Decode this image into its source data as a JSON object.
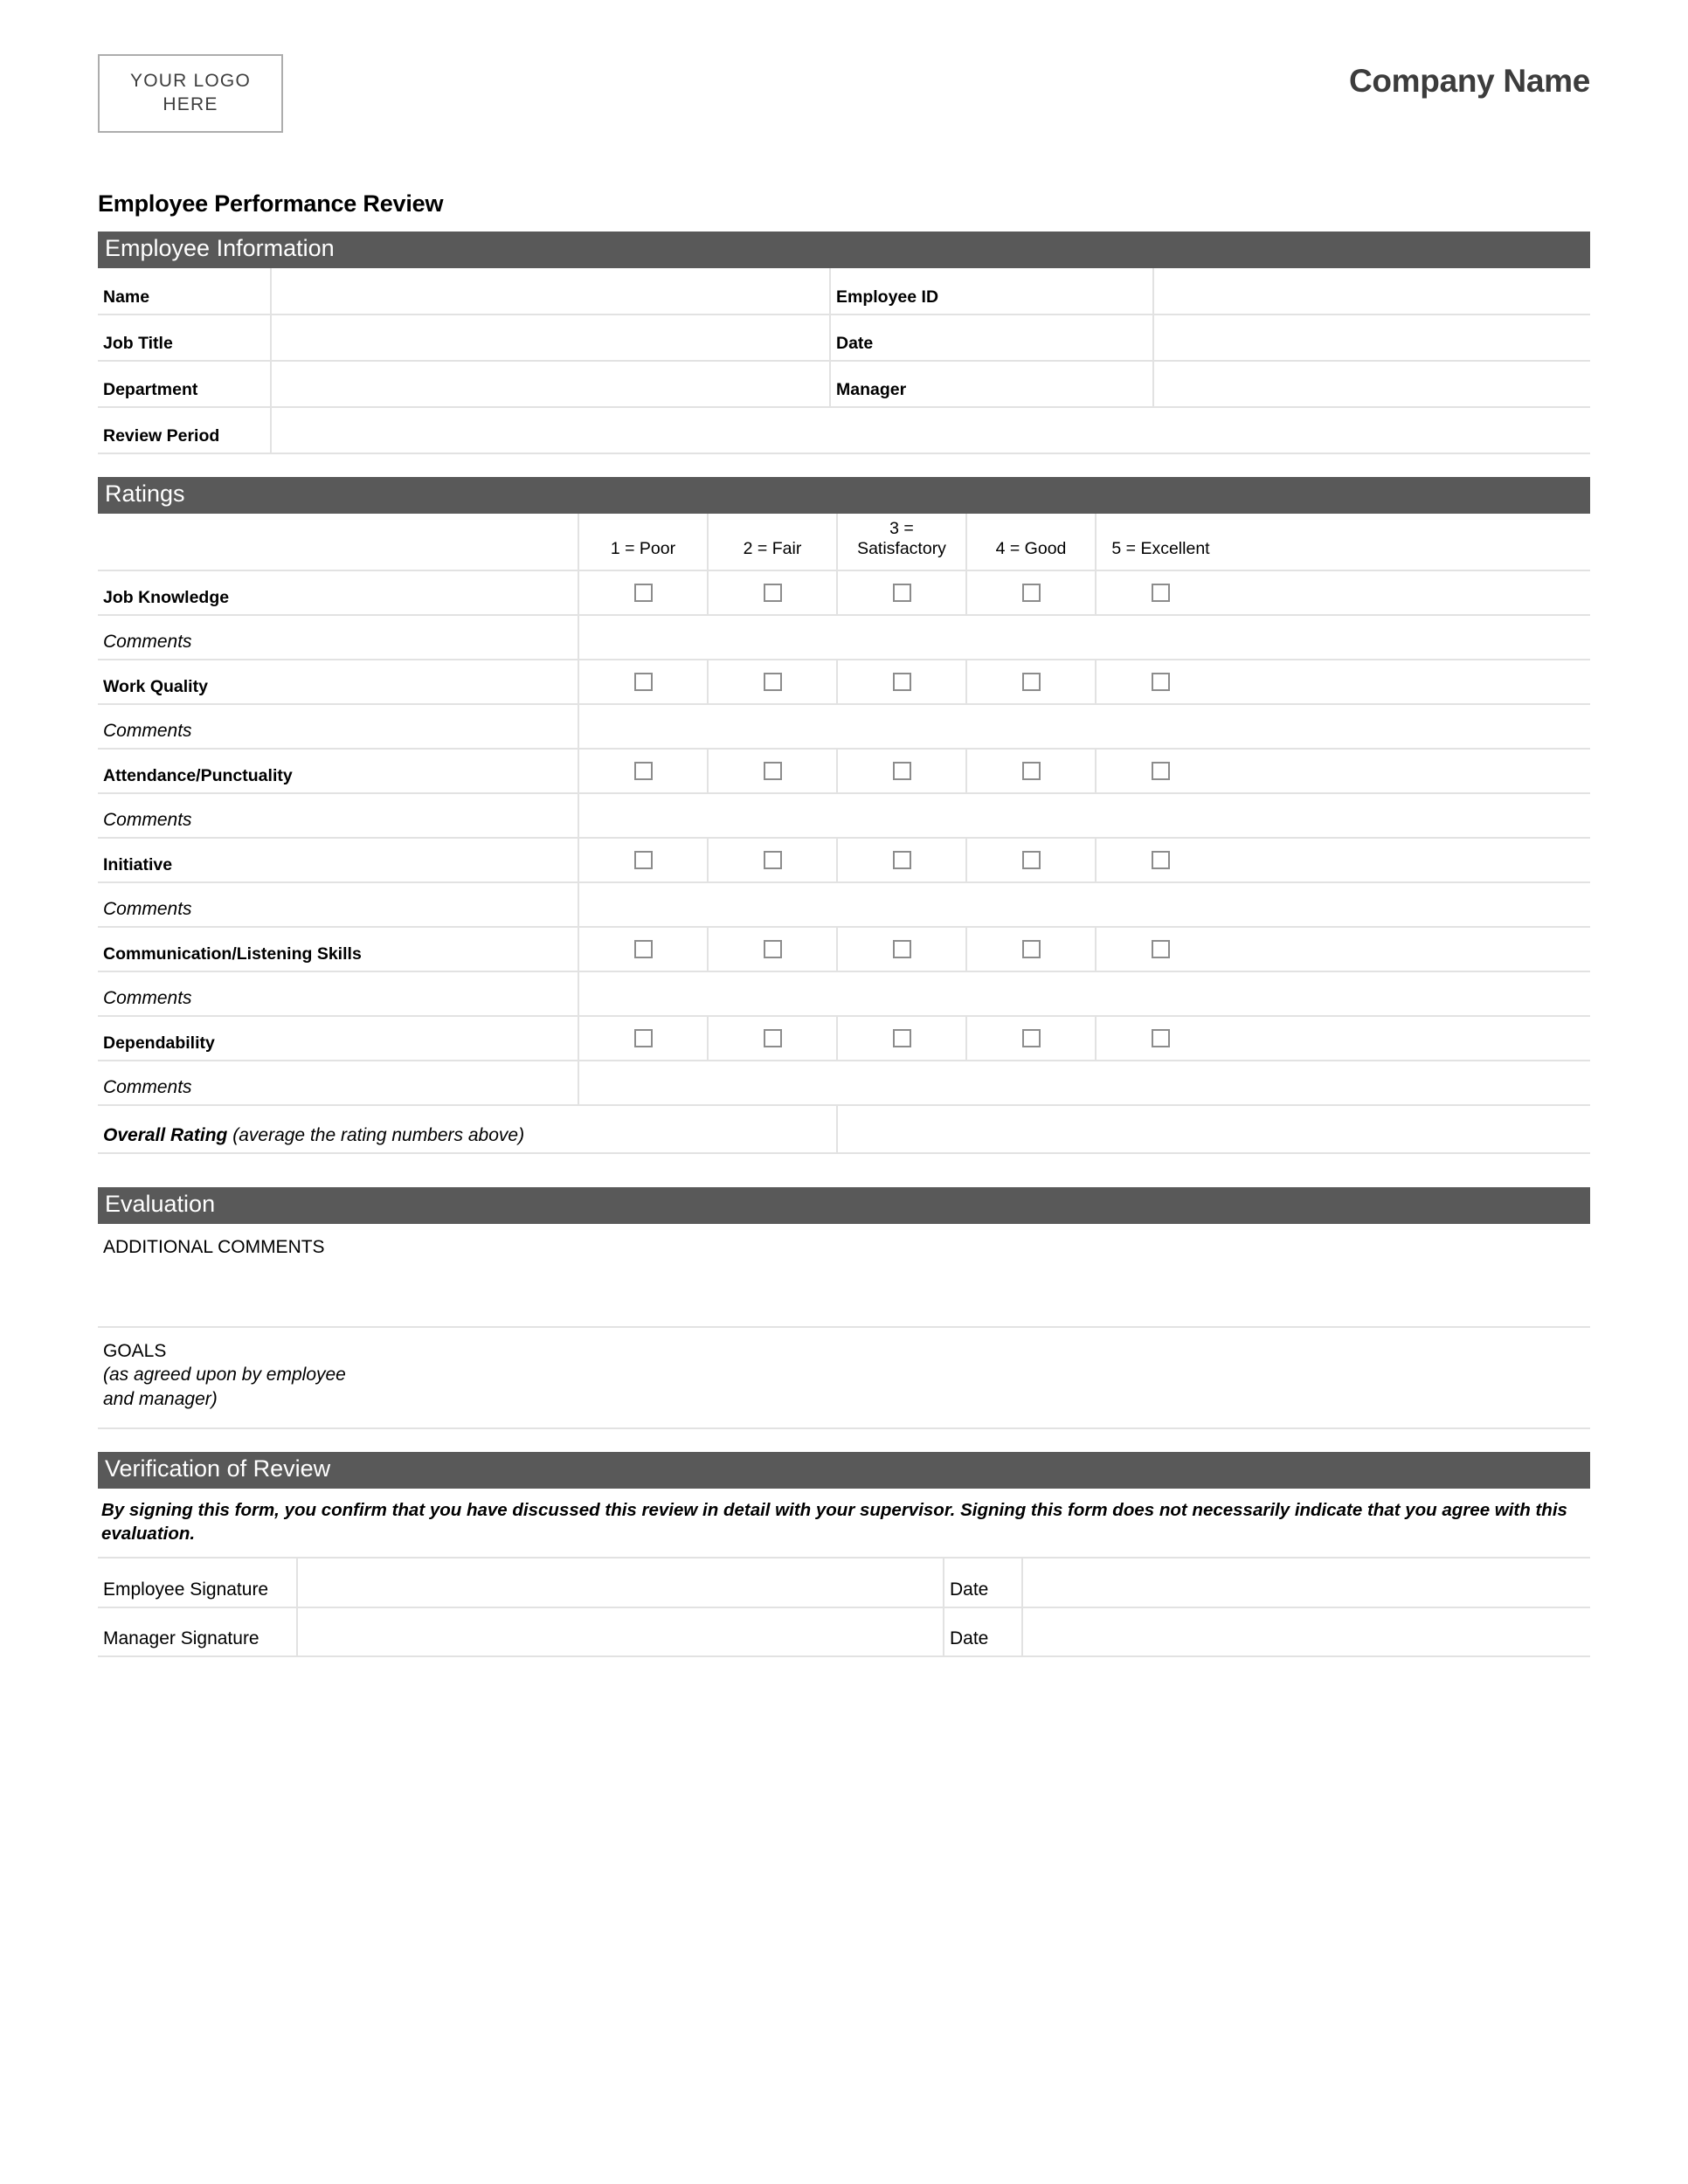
{
  "header": {
    "logo_line1": "YOUR LOGO",
    "logo_line2": "HERE",
    "company_name": "Company Name",
    "form_title": "Employee Performance Review"
  },
  "employee_information": {
    "section_title": "Employee Information",
    "rows": [
      {
        "left_label": "Name",
        "left_value": "",
        "right_label": "Employee ID",
        "right_value": ""
      },
      {
        "left_label": "Job Title",
        "left_value": "",
        "right_label": "Date",
        "right_value": ""
      },
      {
        "left_label": "Department",
        "left_value": "",
        "right_label": "Manager",
        "right_value": ""
      }
    ],
    "review_period_label": "Review Period",
    "review_period_value": ""
  },
  "ratings": {
    "section_title": "Ratings",
    "scale": [
      "1 = Poor",
      "2 = Fair",
      "3 = Satisfactory",
      "4 = Good",
      "5 = Excellent"
    ],
    "comments_label": "Comments",
    "criteria": [
      {
        "label": "Job Knowledge",
        "checked": [
          false,
          false,
          false,
          false,
          false
        ],
        "comment": ""
      },
      {
        "label": "Work Quality",
        "checked": [
          false,
          false,
          false,
          false,
          false
        ],
        "comment": ""
      },
      {
        "label": "Attendance/Punctuality",
        "checked": [
          false,
          false,
          false,
          false,
          false
        ],
        "comment": ""
      },
      {
        "label": "Initiative",
        "checked": [
          false,
          false,
          false,
          false,
          false
        ],
        "comment": ""
      },
      {
        "label": "Communication/Listening Skills",
        "checked": [
          false,
          false,
          false,
          false,
          false
        ],
        "comment": ""
      },
      {
        "label": "Dependability",
        "checked": [
          false,
          false,
          false,
          false,
          false
        ],
        "comment": ""
      }
    ],
    "overall_label_bold": "Overall Rating",
    "overall_label_italic": " (average the rating numbers above)",
    "overall_value": ""
  },
  "evaluation": {
    "section_title": "Evaluation",
    "additional_comments_label": "ADDITIONAL COMMENTS",
    "additional_comments_value": "",
    "goals_label": "GOALS",
    "goals_sub_line1": "(as agreed upon by employee",
    "goals_sub_line2": "and manager)",
    "goals_value": ""
  },
  "verification": {
    "section_title": "Verification of Review",
    "note": "By signing this form, you confirm that you have discussed this review in detail with your supervisor. Signing this form does not necessarily indicate that you agree with this evaluation.",
    "rows": [
      {
        "label": "Employee Signature",
        "signature_value": "",
        "date_label": "Date",
        "date_value": ""
      },
      {
        "label": "Manager Signature",
        "signature_value": "",
        "date_label": "Date",
        "date_value": ""
      }
    ]
  },
  "colors": {
    "section_bar": "#595959",
    "border": "#e2e2e2",
    "checkbox_border": "#8c8c8c",
    "company_name": "#3c3c3c"
  }
}
